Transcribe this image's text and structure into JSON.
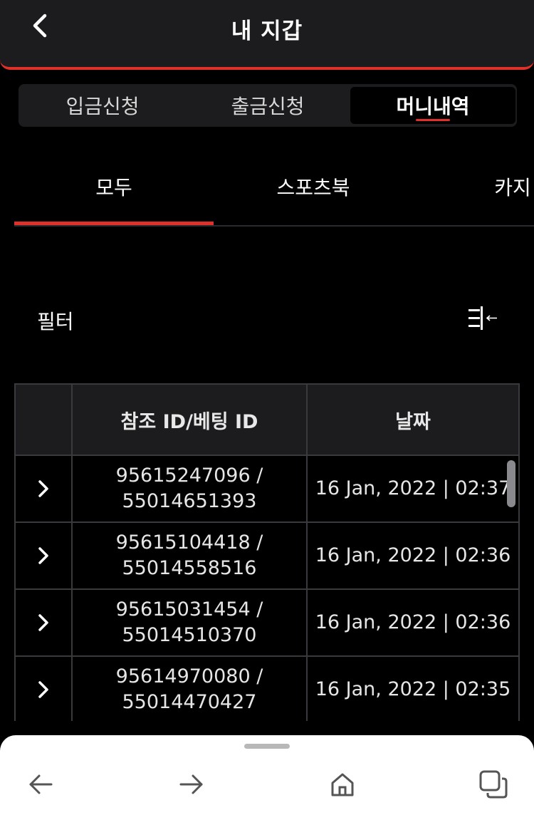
{
  "header": {
    "title": "내 지갑",
    "back_icon": "chevron-left-icon"
  },
  "segment_tabs": [
    {
      "label": "입금신청",
      "active": false
    },
    {
      "label": "출금신청",
      "active": false
    },
    {
      "label": "머니내역",
      "active": true
    }
  ],
  "category_tabs": [
    {
      "label": "모두",
      "active": true
    },
    {
      "label": "스포츠북",
      "active": false
    },
    {
      "label": "카지",
      "active": false
    }
  ],
  "filter": {
    "label": "필터",
    "icon": "filter-collapse-icon"
  },
  "table": {
    "headers": [
      "",
      "참조 ID/베팅 ID",
      "날짜"
    ],
    "rows": [
      {
        "ref_id": "95615247096 /",
        "bet_id": "55014651393",
        "date": "16 Jan, 2022 | 02:37"
      },
      {
        "ref_id": "95615104418 /",
        "bet_id": "55014558516",
        "date": "16 Jan, 2022 | 02:36"
      },
      {
        "ref_id": "95615031454 /",
        "bet_id": "55014510370",
        "date": "16 Jan, 2022 | 02:36"
      },
      {
        "ref_id": "95614970080 /",
        "bet_id": "55014470427",
        "date": "16 Jan, 2022 | 02:35"
      }
    ]
  },
  "browser_bar": {
    "icons": [
      "back-arrow-icon",
      "forward-arrow-icon",
      "home-icon",
      "tabs-icon"
    ]
  },
  "colors": {
    "accent": "#e0302a",
    "background": "#000000",
    "surface": "#1c1c1e",
    "border": "#3a3a3e"
  }
}
